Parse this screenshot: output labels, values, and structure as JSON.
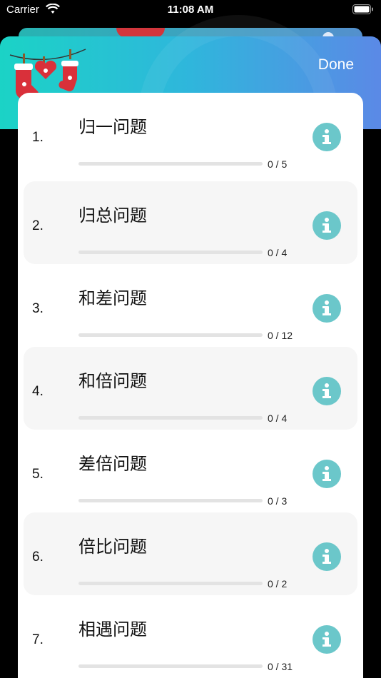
{
  "status_bar": {
    "carrier": "Carrier",
    "time": "11:08 AM"
  },
  "header": {
    "done_label": "Done"
  },
  "colors": {
    "accent": "#6bc7ca",
    "progress_track": "#e3e3e3",
    "gradient_start": "#1bd3c6",
    "gradient_end": "#5b89e6"
  },
  "icons": {
    "info": "info-icon",
    "stockings": "christmas-stockings-icon"
  },
  "topics": [
    {
      "number": "1.",
      "title": "归一问题",
      "progress_text": "0 / 5",
      "progress": 0
    },
    {
      "number": "2.",
      "title": "归总问题",
      "progress_text": "0 / 4",
      "progress": 0
    },
    {
      "number": "3.",
      "title": "和差问题",
      "progress_text": "0 / 12",
      "progress": 0
    },
    {
      "number": "4.",
      "title": "和倍问题",
      "progress_text": "0 / 4",
      "progress": 0
    },
    {
      "number": "5.",
      "title": "差倍问题",
      "progress_text": "0 / 3",
      "progress": 0
    },
    {
      "number": "6.",
      "title": "倍比问题",
      "progress_text": "0 / 2",
      "progress": 0
    },
    {
      "number": "7.",
      "title": "相遇问题",
      "progress_text": "0 / 31",
      "progress": 0
    }
  ]
}
